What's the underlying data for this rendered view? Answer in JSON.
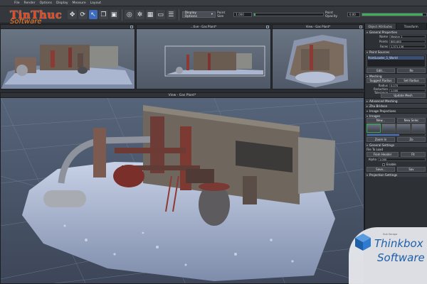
{
  "menu": [
    "File",
    "Render",
    "Options",
    "Display",
    "Measure",
    "Layout"
  ],
  "toolbar": {
    "display_options": "Display Options",
    "point_size_label": "Point Size",
    "point_size_value": "1.000",
    "point_opacity_label": "Point Opacity",
    "point_opacity_value": "0.00",
    "point_opacity_fraction": 0.95
  },
  "logo_tl": {
    "line1": "TinThuc",
    "line2": "Software"
  },
  "viewports": {
    "top1_title": "",
    "top2_title": "...tive - Gas Plant*",
    "top3_title": "View - Gas Plant*",
    "main_title": "View - Gas Plant*"
  },
  "panel": {
    "tabs": [
      "Object Attributes",
      "Transform"
    ],
    "general_properties": "General Properties",
    "props": [
      {
        "label": "Name",
        "value": "Mesher 1"
      },
      {
        "label": "Points",
        "value": "860,660"
      },
      {
        "label": "Faces",
        "value": "1,371,136"
      }
    ],
    "point_sources": "Point Sources",
    "list_item": "PointLoader_1_World",
    "edit_btn": "Edit...",
    "remove_btn": "Re",
    "meshing": "Meshing",
    "suggest_btn": "Suggest Radius",
    "set_btn": "Set Radius",
    "radius_label": "Radius",
    "radius_value": "0.075",
    "reduction_label": "Reduction Tolerance",
    "reduction_value": "1.000",
    "update_btn": "Update Mesh",
    "advanced": "Advanced Meshing",
    "zhu": "Zhu Bridson",
    "image_proj_section": "Image Projections",
    "images": "Images",
    "new_btn": "New...",
    "new_btn2": "New Selec",
    "zoom_in": "Zoom In",
    "zoom_out": "Zo",
    "general_settings": "General Settings",
    "file_to_load": "File To Load",
    "from_header": "From Header",
    "fit_btn": "Fit",
    "alpha_label": "Alpha",
    "alpha_value": "1.000",
    "enable_label": "Enable",
    "save_btn": "Save...",
    "save2_btn": "Sav",
    "proj_settings": "Projection Settings",
    "progress_fraction": 0.55
  },
  "thinkbox": {
    "line1": "Thinkbox",
    "line2": "Software",
    "tagline": "Sub Serapa"
  },
  "colors": {
    "accent": "#3d6cbf",
    "green": "#3fae58",
    "logo_red": "#e8461e",
    "thinkbox_blue": "#1d5fa8"
  }
}
